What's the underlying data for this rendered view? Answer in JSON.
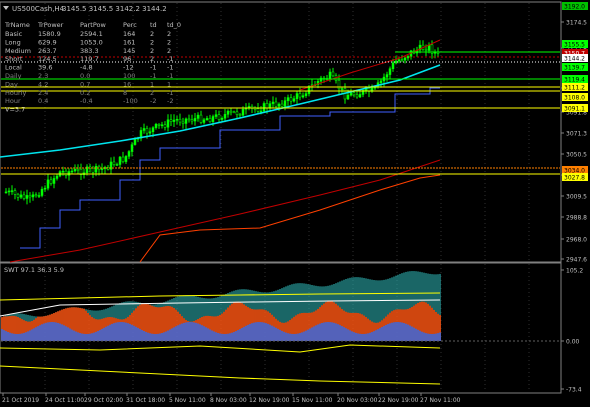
{
  "header": {
    "dropdown_icon": "triangle-down-icon",
    "title": "US500Cash,H4",
    "quote": "3145.5 3145.5 3142.2 3144.2"
  },
  "table": {
    "headers": [
      "TrName",
      "TrPower",
      "PartPow",
      "Perc",
      "td",
      "td_0"
    ],
    "rows": [
      {
        "name": "Basic",
        "power": "1580.9",
        "part": "2594.1",
        "perc": "164",
        "td": "2",
        "td0": "2",
        "color": "#c0c0c0"
      },
      {
        "name": "Long",
        "power": "629.9",
        "part": "1053.0",
        "perc": "161",
        "td": "2",
        "td0": "2",
        "color": "#c0c0c0"
      },
      {
        "name": "Medium",
        "power": "263.7",
        "part": "383.3",
        "perc": "145",
        "td": "2",
        "td0": "2",
        "color": "#c0c0c0"
      },
      {
        "name": "Short",
        "power": "124.5",
        "part": "119.7",
        "perc": "96",
        "td": "2",
        "td0": "-1",
        "color": "#c0c0c0"
      },
      {
        "name": "Local",
        "power": "39.6",
        "part": "-4.8",
        "perc": "-12",
        "td": "-1",
        "td0": "-1",
        "color": "#c0c0c0"
      },
      {
        "name": "Daily",
        "power": "2.3",
        "part": "0.0",
        "perc": "100",
        "td": "-1",
        "td0": "-1",
        "color": "#808080"
      },
      {
        "name": "Day",
        "power": "4.2",
        "part": "0.7",
        "perc": "16",
        "td": "1",
        "td0": "1",
        "color": "#808080"
      },
      {
        "name": "Hourly",
        "power": "2.4",
        "part": "0.2",
        "perc": "8",
        "td": "2",
        "td0": "-1",
        "color": "#808080"
      },
      {
        "name": "Hour",
        "power": "0.4",
        "part": "-0.4",
        "perc": "-100",
        "td": "-2",
        "td0": "-2",
        "color": "#808080"
      }
    ],
    "footer": "V=3.7"
  },
  "price_axis": {
    "ticks": [
      "3174.5",
      "3133.8",
      "3112.3",
      "3091.8",
      "3071.3",
      "3050.5",
      "3030.0",
      "3009.5",
      "2988.8",
      "2968.0",
      "2947.6"
    ],
    "labels": [
      {
        "text": "3192.0",
        "bg": "#00c000",
        "fg": "#000000"
      },
      {
        "text": "3155.5",
        "bg": "#00ff00",
        "fg": "#000000"
      },
      {
        "text": "3150.7",
        "bg": "#c00000",
        "fg": "#ffffff"
      },
      {
        "text": "3144.2",
        "bg": "#ffffff",
        "fg": "#000000"
      },
      {
        "text": "3139.7",
        "bg": "#00ff00",
        "fg": "#000000"
      },
      {
        "text": "3119.4",
        "bg": "#00ff00",
        "fg": "#000000"
      },
      {
        "text": "3111.2",
        "bg": "#ffff00",
        "fg": "#000000"
      },
      {
        "text": "3108.0",
        "bg": "#ffff00",
        "fg": "#000000"
      },
      {
        "text": "3091.1",
        "bg": "#ffff00",
        "fg": "#000000"
      },
      {
        "text": "3034.0",
        "bg": "#ff8000",
        "fg": "#000000"
      },
      {
        "text": "3027.8",
        "bg": "#ffff00",
        "fg": "#000000"
      }
    ]
  },
  "indicator": {
    "label": "SWT 97.1 36.3 5.9",
    "ticks": [
      "105.2",
      "0.00",
      "-73.4"
    ]
  },
  "time_axis": {
    "labels": [
      "21 Oct 2019",
      "24 Oct 11:00",
      "29 Oct 02:00",
      "31 Oct 18:00",
      "5 Nov 11:00",
      "8 Nov 03:00",
      "12 Nov 19:00",
      "15 Nov 11:00",
      "20 Nov 03:00",
      "22 Nov 19:00",
      "27 Nov 11:00"
    ]
  },
  "colors": {
    "background": "#000000",
    "grid": "#303030",
    "bull": "#00ff00",
    "bear": "#000000",
    "ma_cyan": "#00e5ee",
    "trend_red": "#c00000",
    "trend_orange": "#ff4000",
    "support_blue": "#4060ff",
    "level_yellow": "#ffff00",
    "level_green": "#00ff00",
    "hist_orange": "#ff4500",
    "hist_teal": "#208080",
    "hist_blue": "#4169e1"
  }
}
